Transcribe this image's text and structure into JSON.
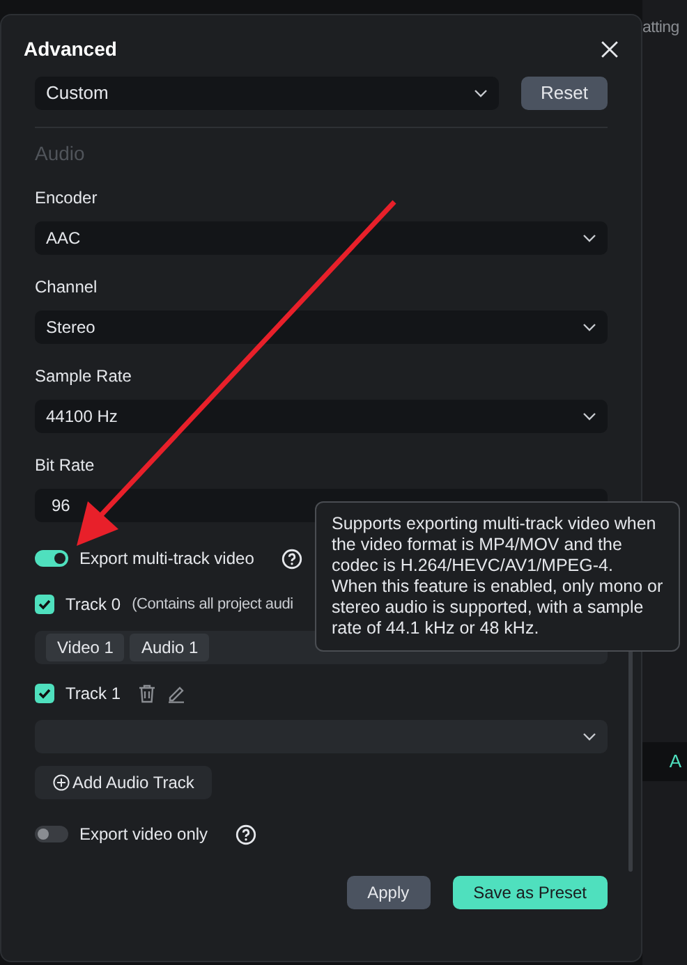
{
  "background": {
    "tab_label": "atting",
    "column_label": "A"
  },
  "dialog": {
    "title": "Advanced",
    "preset": "Custom",
    "reset": "Reset",
    "section": "Audio",
    "fields": [
      {
        "label": "Encoder",
        "kind": "select",
        "value": "AAC"
      },
      {
        "label": "Channel",
        "kind": "select",
        "value": "Stereo"
      },
      {
        "label": "Sample Rate",
        "kind": "select",
        "value": "44100 Hz"
      },
      {
        "label": "Bit Rate",
        "kind": "input",
        "value": "96"
      }
    ],
    "multitrack": {
      "label": "Export multi-track video",
      "on": true,
      "tooltip": "Supports exporting multi-track video when the video format is MP4/MOV and the codec is H.264/HEVC/AV1/MPEG-4. When this feature is enabled, only mono or stereo audio is supported, with a sample rate of 44.1 kHz or 48 kHz."
    },
    "tracks": [
      {
        "label": "Track 0",
        "note": "(Contains all project audi",
        "checked": true,
        "kind": "tags",
        "tags": [
          "Video 1",
          "Audio 1"
        ],
        "editable": false
      },
      {
        "label": "Track 1",
        "checked": true,
        "kind": "select",
        "editable": true
      }
    ],
    "add_track": "Add Audio Track",
    "video_only": {
      "label": "Export video only",
      "on": false
    },
    "buttons": [
      {
        "label": "Apply",
        "kind": "secondary"
      },
      {
        "label": "Save as Preset",
        "kind": "primary"
      }
    ]
  }
}
